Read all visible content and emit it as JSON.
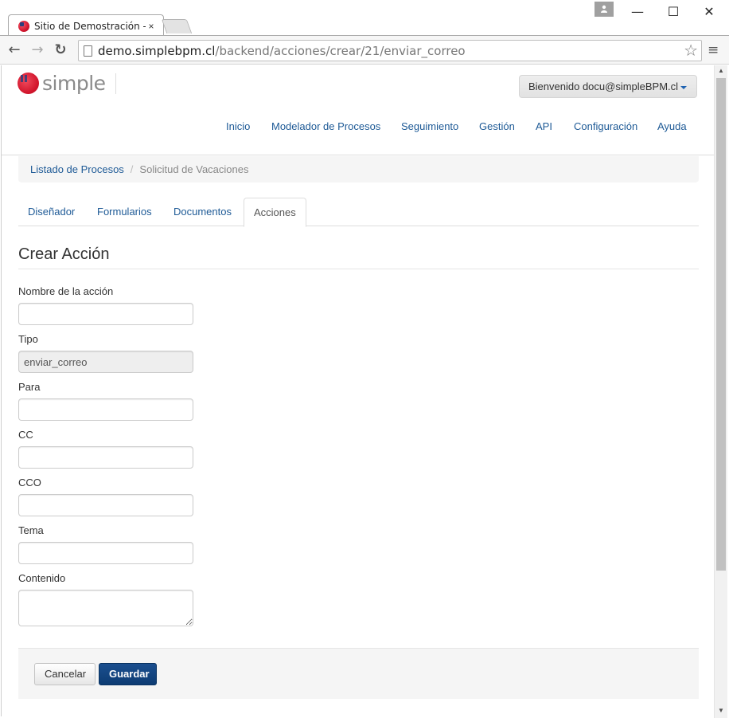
{
  "browser": {
    "tab_title": "Sitio de Demostración - C",
    "tab_close": "×",
    "url_host": "demo.simplebpm.cl",
    "url_path": "/backend/acciones/crear/21/enviar_correo",
    "minimize": "—",
    "maximize": "☐",
    "close": "✕",
    "back": "←",
    "forward": "→",
    "reload": "↻",
    "bookmark_star": "☆",
    "menu": "≡"
  },
  "header": {
    "logo_text": "simple",
    "user_menu": "Bienvenido docu@simpleBPM.cl"
  },
  "nav": {
    "items": [
      "Inicio",
      "Modelador de Procesos",
      "Seguimiento",
      "Gestión",
      "API",
      "Configuración",
      "Ayuda"
    ]
  },
  "breadcrumb": {
    "parent": "Listado de Procesos",
    "separator": "/",
    "current": "Solicitud de Vacaciones"
  },
  "tabs": {
    "items": [
      "Diseñador",
      "Formularios",
      "Documentos",
      "Acciones"
    ],
    "active": "Acciones"
  },
  "form": {
    "title": "Crear Acción",
    "fields": {
      "nombre": {
        "label": "Nombre de la acción",
        "value": ""
      },
      "tipo": {
        "label": "Tipo",
        "value": "enviar_correo"
      },
      "para": {
        "label": "Para",
        "value": ""
      },
      "cc": {
        "label": "CC",
        "value": ""
      },
      "cco": {
        "label": "CCO",
        "value": ""
      },
      "tema": {
        "label": "Tema",
        "value": ""
      },
      "contenido": {
        "label": "Contenido",
        "value": ""
      }
    },
    "cancel_label": "Cancelar",
    "save_label": "Guardar"
  },
  "colors": {
    "link": "#1e5a96",
    "primary_button": "#0d3c73",
    "logo_red": "#d2152c"
  },
  "icons": {
    "favicon": "simple-logo-icon",
    "page": "page-icon",
    "profile": "person-icon",
    "caret": "caret-down-icon"
  }
}
